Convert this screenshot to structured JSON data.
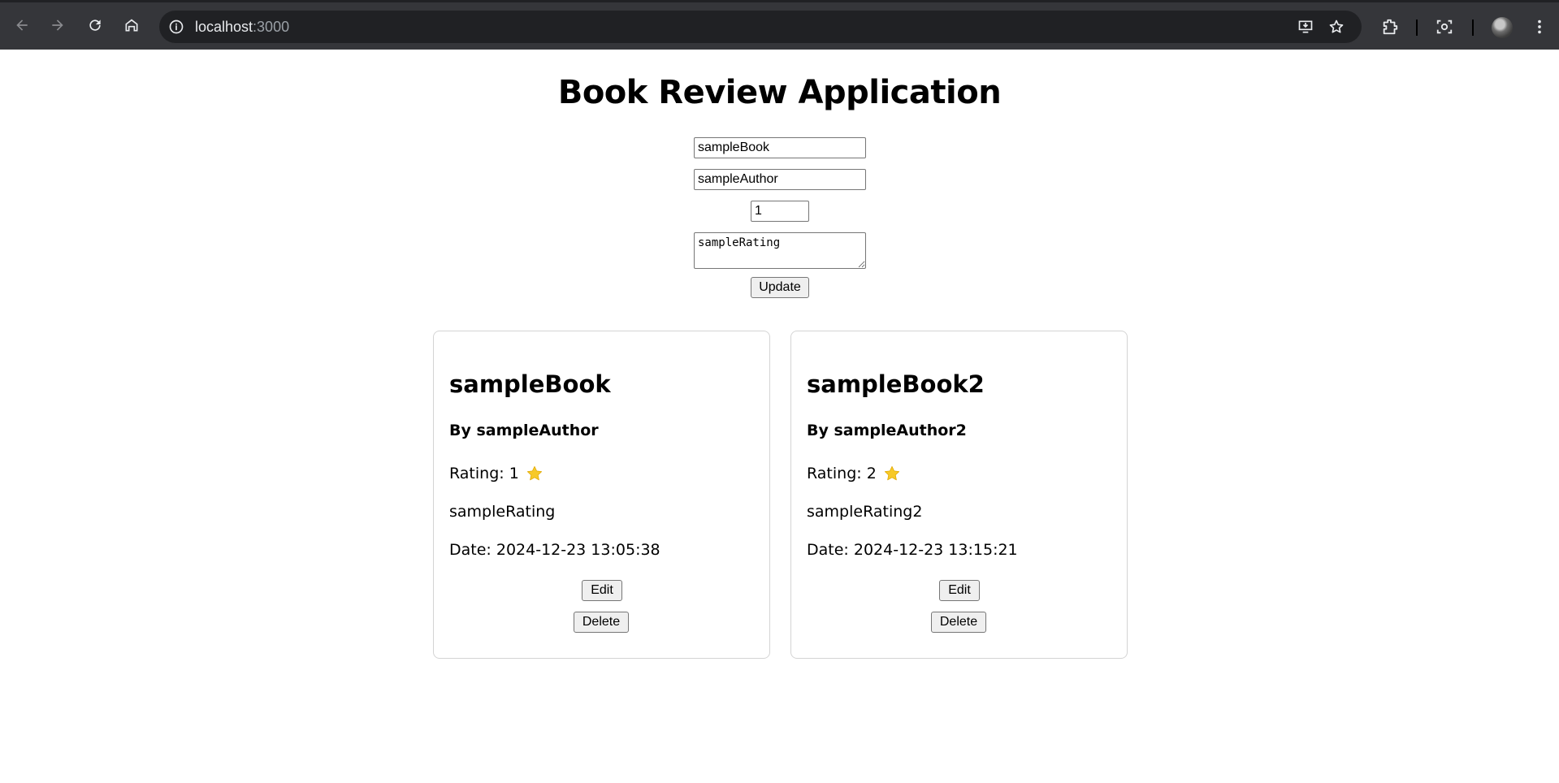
{
  "browser": {
    "url_host": "localhost",
    "url_port": ":3000",
    "icons": [
      "back-icon",
      "forward-icon",
      "reload-icon",
      "home-icon",
      "site-info-icon",
      "install-app-icon",
      "bookmark-star-icon",
      "extensions-icon",
      "screenshot-icon",
      "profile-avatar",
      "menu-kebab-icon"
    ]
  },
  "page": {
    "title": "Book Review Application"
  },
  "form": {
    "title_value": "sampleBook",
    "author_value": "sampleAuthor",
    "rating_value": "1",
    "review_value": "sampleRating",
    "submit_label": "Update"
  },
  "reviews": [
    {
      "title": "sampleBook",
      "author_line": "By sampleAuthor",
      "rating_line": "Rating: 1",
      "review": "sampleRating",
      "date_line": "Date: 2024-12-23 13:05:38",
      "edit_label": "Edit",
      "delete_label": "Delete"
    },
    {
      "title": "sampleBook2",
      "author_line": "By sampleAuthor2",
      "rating_line": "Rating: 2",
      "review": "sampleRating2",
      "date_line": "Date: 2024-12-23 13:15:21",
      "edit_label": "Edit",
      "delete_label": "Delete"
    }
  ],
  "colors": {
    "chrome_bg": "#35363a",
    "omnibox_bg": "#202124",
    "star": "#f7c928",
    "card_border": "#d4d4d4"
  }
}
